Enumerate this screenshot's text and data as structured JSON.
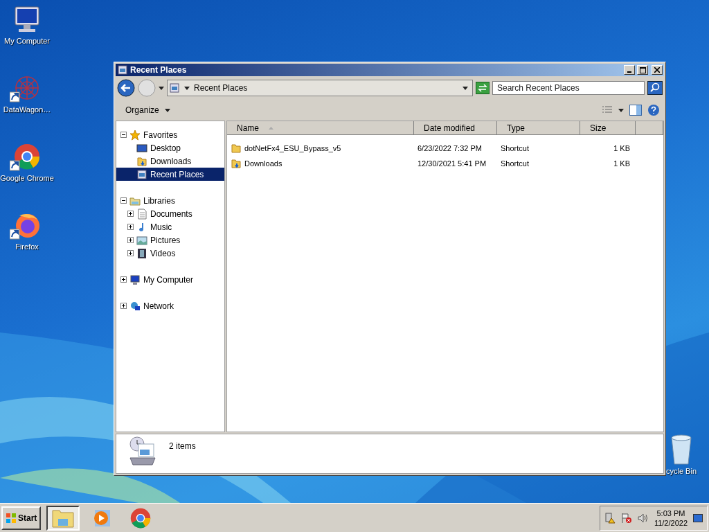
{
  "desktop_icons": [
    {
      "label": "My Computer",
      "kind": "computer",
      "shortcut": false
    },
    {
      "label": "DataWagon…",
      "kind": "datawagon",
      "shortcut": true
    },
    {
      "label": "Google Chrome",
      "kind": "chrome",
      "shortcut": true
    },
    {
      "label": "Firefox",
      "kind": "firefox",
      "shortcut": true
    }
  ],
  "recycle_bin": {
    "label": "cycle Bin"
  },
  "window": {
    "title": "Recent Places",
    "address": {
      "path": "Recent Places"
    },
    "search": {
      "placeholder": "Search Recent Places"
    },
    "toolbar": {
      "organize": "Organize"
    },
    "sidebar": [
      {
        "label": "Favorites",
        "kind": "star",
        "expanded": true,
        "selected": false,
        "children": [
          {
            "label": "Desktop",
            "kind": "desktop",
            "selected": false
          },
          {
            "label": "Downloads",
            "kind": "downloads",
            "selected": false
          },
          {
            "label": "Recent Places",
            "kind": "recent",
            "selected": true
          }
        ]
      },
      {
        "label": "Libraries",
        "kind": "library",
        "expanded": true,
        "selected": false,
        "children": [
          {
            "label": "Documents",
            "kind": "document",
            "expanded": false,
            "selected": false
          },
          {
            "label": "Music",
            "kind": "music",
            "expanded": false,
            "selected": false
          },
          {
            "label": "Pictures",
            "kind": "pictures",
            "expanded": false,
            "selected": false
          },
          {
            "label": "Videos",
            "kind": "videos",
            "expanded": false,
            "selected": false
          }
        ]
      },
      {
        "label": "My Computer",
        "kind": "computer",
        "expanded": false,
        "selected": false
      },
      {
        "label": "Network",
        "kind": "network",
        "expanded": false,
        "selected": false
      }
    ],
    "table": {
      "columns": [
        {
          "label": "Name",
          "sorted": true
        },
        {
          "label": "Date modified",
          "sorted": false
        },
        {
          "label": "Type",
          "sorted": false
        },
        {
          "label": "Size",
          "sorted": false
        }
      ],
      "rows": [
        {
          "kind": "folder",
          "name": "dotNetFx4_ESU_Bypass_v5",
          "date": "6/23/2022 7:32 PM",
          "type": "Shortcut",
          "size": "1 KB"
        },
        {
          "kind": "downloads",
          "name": "Downloads",
          "date": "12/30/2021 5:41 PM",
          "type": "Shortcut",
          "size": "1 KB"
        }
      ]
    },
    "status": "2 items"
  },
  "taskbar": {
    "start": "Start",
    "apps": [
      {
        "kind": "explorer",
        "selected": true
      },
      {
        "kind": "media",
        "selected": false
      },
      {
        "kind": "chrome",
        "selected": false
      }
    ],
    "clock": {
      "time": "5:03 PM",
      "date": "11/2/2022"
    }
  }
}
